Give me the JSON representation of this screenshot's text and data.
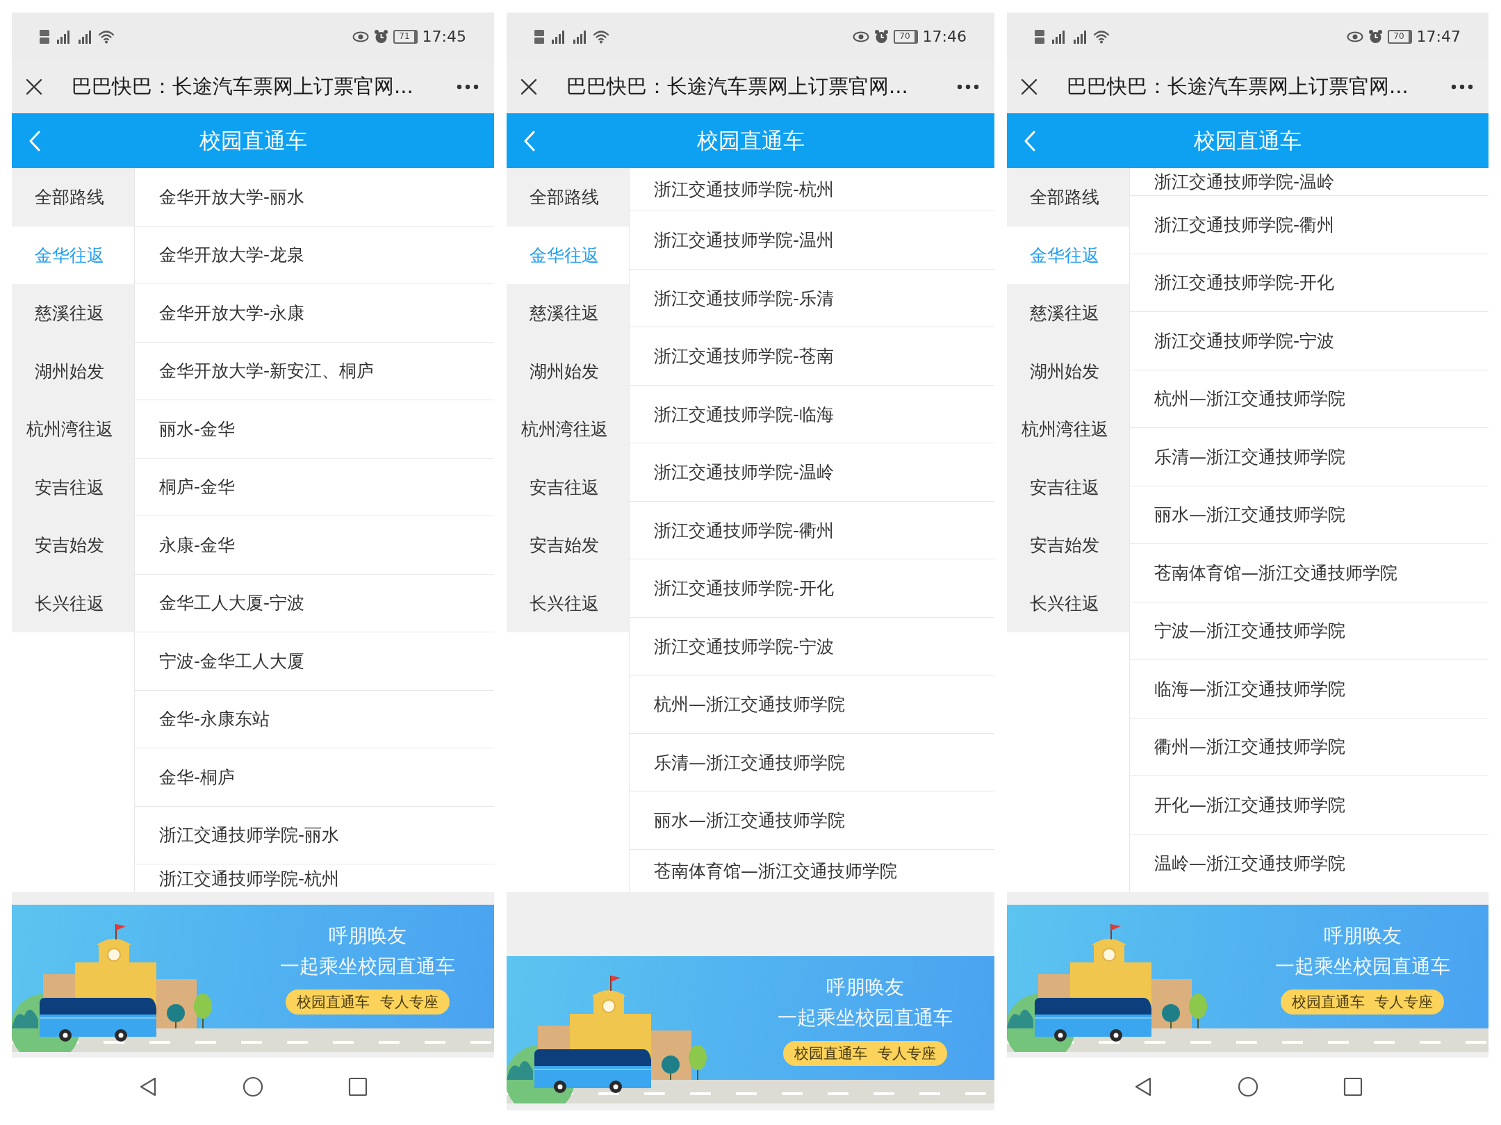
{
  "screens": [
    {
      "status_bar": {
        "battery": "71",
        "time": "17:45"
      },
      "title_bar": {
        "title": "巴巴快巴：长途汽车票网上订票官网..."
      },
      "header": {
        "title": "校园直通车"
      },
      "categories": [
        {
          "label": "全部路线",
          "selected": false
        },
        {
          "label": "金华往返",
          "selected": true
        },
        {
          "label": "慈溪往返",
          "selected": false
        },
        {
          "label": "湖州始发",
          "selected": false
        },
        {
          "label": "杭州湾往返",
          "selected": false
        },
        {
          "label": "安吉往返",
          "selected": false
        },
        {
          "label": "安吉始发",
          "selected": false
        },
        {
          "label": "长兴往返",
          "selected": false
        }
      ],
      "routes": {
        "rows": [
          "金华开放大学-丽水",
          "金华开放大学-龙泉",
          "金华开放大学-永康",
          "金华开放大学-新安江、桐庐",
          "丽水-金华",
          "桐庐-金华",
          "永康-金华",
          "金华工人大厦-宁波",
          "宁波-金华工人大厦",
          "金华-永康东站",
          "金华-桐庐",
          "浙江交通技师学院-丽水"
        ],
        "bottom_partial": "浙江交通技师学院-杭州"
      },
      "banner": {
        "headline": "呼朋唤友",
        "subline": "一起乘坐校园直通车",
        "tag": "校园直通车 专人专座"
      },
      "nav_bar": true
    },
    {
      "status_bar": {
        "battery": "70",
        "time": "17:46"
      },
      "title_bar": {
        "title": "巴巴快巴：长途汽车票网上订票官网..."
      },
      "header": {
        "title": "校园直通车"
      },
      "categories": [
        {
          "label": "全部路线",
          "selected": false
        },
        {
          "label": "金华往返",
          "selected": true
        },
        {
          "label": "慈溪往返",
          "selected": false
        },
        {
          "label": "湖州始发",
          "selected": false
        },
        {
          "label": "杭州湾往返",
          "selected": false
        },
        {
          "label": "安吉往返",
          "selected": false
        },
        {
          "label": "安吉始发",
          "selected": false
        },
        {
          "label": "长兴往返",
          "selected": false
        }
      ],
      "routes": {
        "top_partial": "浙江交通技师学院-杭州",
        "rows": [
          "浙江交通技师学院-温州",
          "浙江交通技师学院-乐清",
          "浙江交通技师学院-苍南",
          "浙江交通技师学院-临海",
          "浙江交通技师学院-温岭",
          "浙江交通技师学院-衢州",
          "浙江交通技师学院-开化",
          "浙江交通技师学院-宁波",
          "杭州—浙江交通技师学院",
          "乐清—浙江交通技师学院",
          "丽水—浙江交通技师学院"
        ],
        "bottom_partial": "苍南体育馆—浙江交通技师学院"
      },
      "banner": {
        "headline": "呼朋唤友",
        "subline": "一起乘坐校园直通车",
        "tag": "校园直通车 专人专座"
      },
      "nav_bar": false
    },
    {
      "status_bar": {
        "battery": "70",
        "time": "17:47"
      },
      "title_bar": {
        "title": "巴巴快巴：长途汽车票网上订票官网..."
      },
      "header": {
        "title": "校园直通车"
      },
      "categories": [
        {
          "label": "全部路线",
          "selected": false
        },
        {
          "label": "金华往返",
          "selected": true
        },
        {
          "label": "慈溪往返",
          "selected": false
        },
        {
          "label": "湖州始发",
          "selected": false
        },
        {
          "label": "杭州湾往返",
          "selected": false
        },
        {
          "label": "安吉往返",
          "selected": false
        },
        {
          "label": "安吉始发",
          "selected": false
        },
        {
          "label": "长兴往返",
          "selected": false
        }
      ],
      "routes": {
        "top_partial": "浙江交通技师学院-温岭",
        "rows": [
          "浙江交通技师学院-衢州",
          "浙江交通技师学院-开化",
          "浙江交通技师学院-宁波",
          "杭州—浙江交通技师学院",
          "乐清—浙江交通技师学院",
          "丽水—浙江交通技师学院",
          "苍南体育馆—浙江交通技师学院",
          "宁波—浙江交通技师学院",
          "临海—浙江交通技师学院",
          "衢州—浙江交通技师学院",
          "开化—浙江交通技师学院",
          "温岭—浙江交通技师学院"
        ]
      },
      "banner": {
        "headline": "呼朋唤友",
        "subline": "一起乘坐校园直通车",
        "tag": "校园直通车 专人专座"
      },
      "nav_bar": true
    }
  ]
}
